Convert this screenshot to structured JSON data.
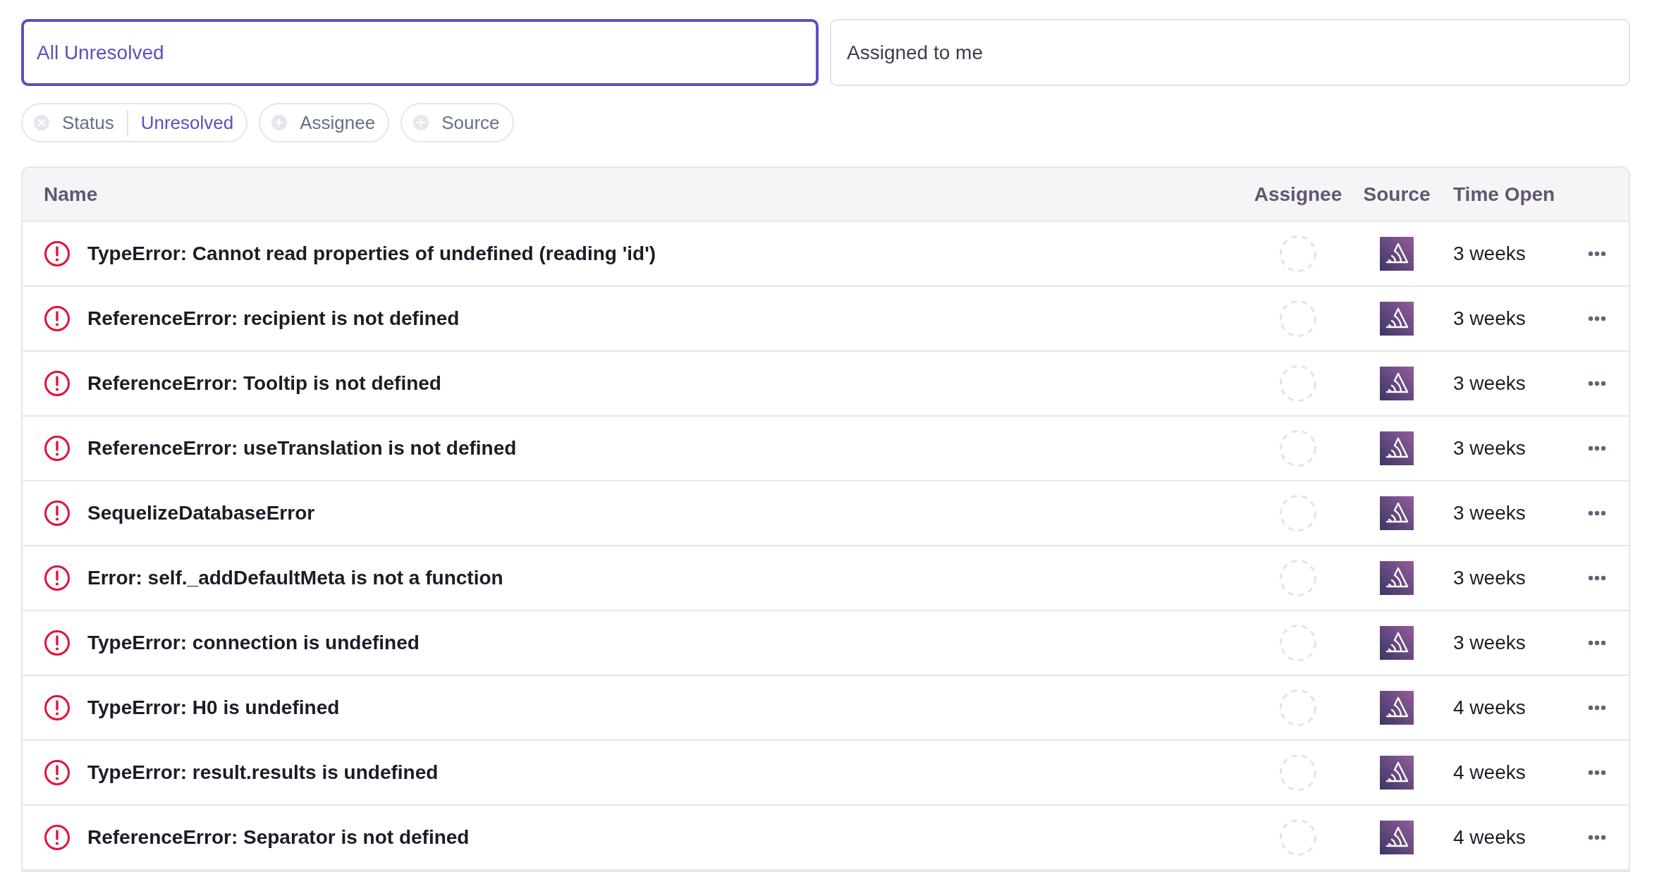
{
  "tabs": [
    {
      "label": "All Unresolved",
      "selected": true
    },
    {
      "label": "Assigned to me",
      "selected": false
    }
  ],
  "filters": [
    {
      "kind": "applied",
      "label": "Status",
      "value": "Unresolved"
    },
    {
      "kind": "add",
      "label": "Assignee"
    },
    {
      "kind": "add",
      "label": "Source"
    }
  ],
  "table": {
    "columns": [
      "Name",
      "Assignee",
      "Source",
      "Time Open"
    ],
    "rows": [
      {
        "name": "TypeError: Cannot read properties of undefined (reading 'id')",
        "time_open": "3 weeks"
      },
      {
        "name": "ReferenceError: recipient is not defined",
        "time_open": "3 weeks"
      },
      {
        "name": "ReferenceError: Tooltip is not defined",
        "time_open": "3 weeks"
      },
      {
        "name": "ReferenceError: useTranslation is not defined",
        "time_open": "3 weeks"
      },
      {
        "name": "SequelizeDatabaseError",
        "time_open": "3 weeks"
      },
      {
        "name": "Error: self._addDefaultMeta is not a function",
        "time_open": "3 weeks"
      },
      {
        "name": "TypeError: connection is undefined",
        "time_open": "3 weeks"
      },
      {
        "name": "TypeError: H0 is undefined",
        "time_open": "4 weeks"
      },
      {
        "name": "TypeError: result.results is undefined",
        "time_open": "4 weeks"
      },
      {
        "name": "ReferenceError: Separator is not defined",
        "time_open": "4 weeks"
      }
    ]
  }
}
